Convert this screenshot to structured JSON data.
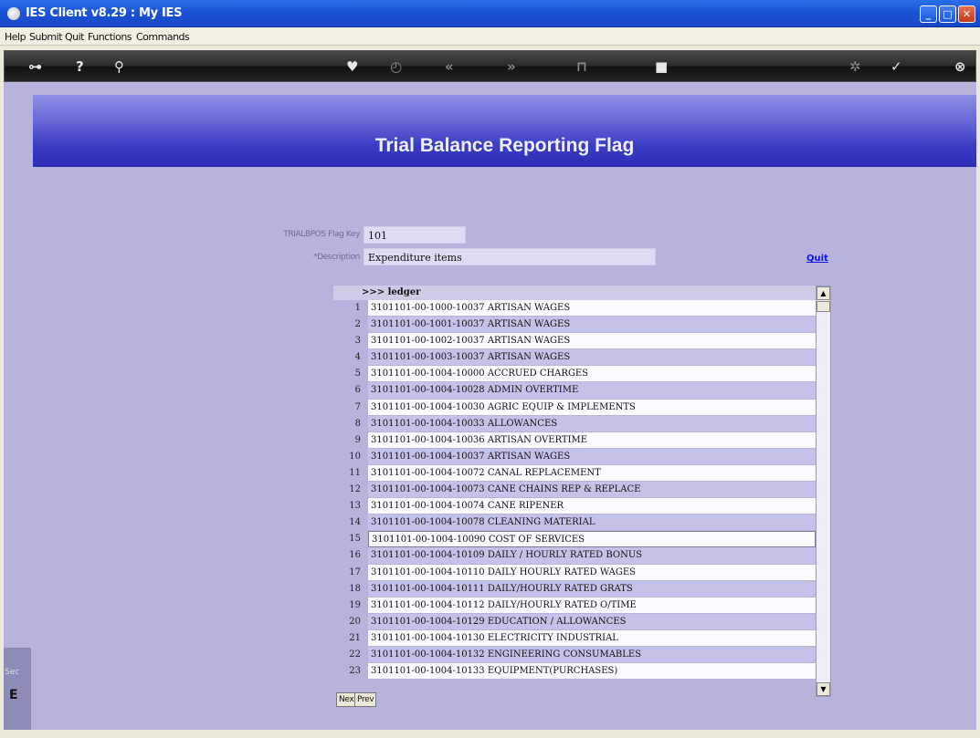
{
  "window": {
    "title": "IES Client v8.29 : My IES"
  },
  "menubar": {
    "items": [
      "Help",
      "Submit",
      "Quit",
      "Functions",
      "Commands"
    ]
  },
  "toolbar": {
    "icons": [
      "key-icon",
      "help-icon",
      "search-icon",
      "heart-icon",
      "clock-icon",
      "back-icon",
      "forward-icon",
      "filter-icon",
      "stop-icon",
      "settings-icon",
      "check-icon",
      "close-icon"
    ]
  },
  "page": {
    "title": "Trial Balance Reporting Flag"
  },
  "form": {
    "flag_key_label": "TRIALBPOS Flag Key",
    "flag_key_value": "101",
    "description_label": "*Description",
    "description_value": "Expenditure items",
    "quit_label": "Quit"
  },
  "grid": {
    "header": ">>> ledger",
    "rows": [
      {
        "n": "1",
        "v": "3101101-00-1000-10037 ARTISAN WAGES"
      },
      {
        "n": "2",
        "v": "3101101-00-1001-10037 ARTISAN WAGES"
      },
      {
        "n": "3",
        "v": "3101101-00-1002-10037 ARTISAN WAGES"
      },
      {
        "n": "4",
        "v": "3101101-00-1003-10037 ARTISAN WAGES"
      },
      {
        "n": "5",
        "v": "3101101-00-1004-10000 ACCRUED CHARGES"
      },
      {
        "n": "6",
        "v": "3101101-00-1004-10028 ADMIN OVERTIME"
      },
      {
        "n": "7",
        "v": "3101101-00-1004-10030 AGRIC EQUIP & IMPLEMENTS"
      },
      {
        "n": "8",
        "v": "3101101-00-1004-10033 ALLOWANCES"
      },
      {
        "n": "9",
        "v": "3101101-00-1004-10036 ARTISAN OVERTIME"
      },
      {
        "n": "10",
        "v": "3101101-00-1004-10037 ARTISAN WAGES"
      },
      {
        "n": "11",
        "v": "3101101-00-1004-10072 CANAL REPLACEMENT"
      },
      {
        "n": "12",
        "v": "3101101-00-1004-10073 CANE CHAINS REP & REPLACE"
      },
      {
        "n": "13",
        "v": "3101101-00-1004-10074 CANE RIPENER"
      },
      {
        "n": "14",
        "v": "3101101-00-1004-10078 CLEANING MATERIAL"
      },
      {
        "n": "15",
        "v": "3101101-00-1004-10090 COST OF SERVICES"
      },
      {
        "n": "16",
        "v": "3101101-00-1004-10109 DAILY / HOURLY RATED BONUS"
      },
      {
        "n": "17",
        "v": "3101101-00-1004-10110 DAILY HOURLY RATED WAGES"
      },
      {
        "n": "18",
        "v": "3101101-00-1004-10111 DAILY/HOURLY RATED GRATS"
      },
      {
        "n": "19",
        "v": "3101101-00-1004-10112 DAILY/HOURLY RATED O/TIME"
      },
      {
        "n": "20",
        "v": "3101101-00-1004-10129 EDUCATION / ALLOWANCES"
      },
      {
        "n": "21",
        "v": "3101101-00-1004-10130 ELECTRICITY INDUSTRIAL"
      },
      {
        "n": "22",
        "v": "3101101-00-1004-10132 ENGINEERING CONSUMABLES"
      },
      {
        "n": "23",
        "v": "3101101-00-1004-10133 EQUIPMENT(PURCHASES)"
      }
    ],
    "next_label": "Next",
    "prev_label": "Prev"
  },
  "side": {
    "text": "Sec",
    "letter": "E"
  }
}
